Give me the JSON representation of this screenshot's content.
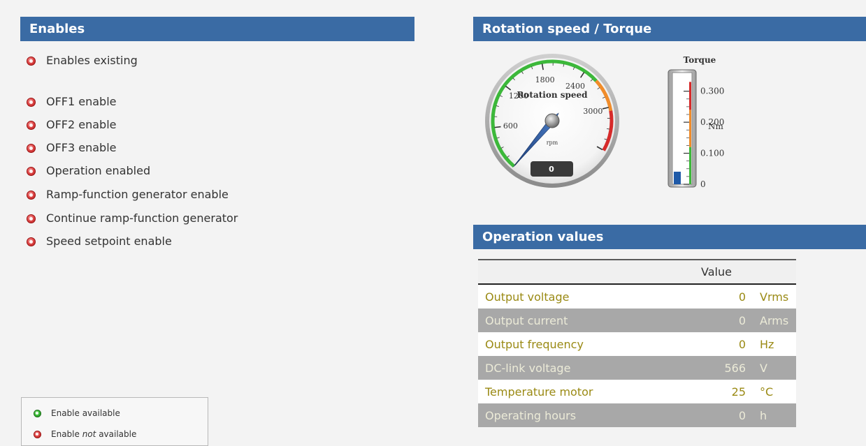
{
  "enables": {
    "title": "Enables",
    "items": [
      {
        "label": "Enables existing",
        "status": "not-available"
      },
      {
        "label": "OFF1 enable",
        "status": "not-available"
      },
      {
        "label": "OFF2 enable",
        "status": "not-available"
      },
      {
        "label": "OFF3 enable",
        "status": "not-available"
      },
      {
        "label": "Operation enabled",
        "status": "not-available"
      },
      {
        "label": "Ramp-function generator enable",
        "status": "not-available"
      },
      {
        "label": "Continue ramp-function generator",
        "status": "not-available"
      },
      {
        "label": "Speed setpoint enable",
        "status": "not-available"
      }
    ],
    "legend": {
      "available_label": "Enable available",
      "not_available_prefix": "Enable",
      "not_available_emphasis": "not",
      "not_available_suffix": "available"
    }
  },
  "rotation": {
    "title": "Rotation speed / Torque",
    "speed_gauge": {
      "title": "Rotation speed",
      "unit": "rpm",
      "tick_labels": [
        "600",
        "1200",
        "1800",
        "2400",
        "3000"
      ],
      "min": 0,
      "max": 3600,
      "value": 0,
      "readout": "0"
    },
    "torque_gauge": {
      "title": "Torque",
      "unit": "Nm",
      "tick_labels": [
        "0",
        "0.100",
        "0.200",
        "0.300"
      ],
      "value": 0
    }
  },
  "operation": {
    "title": "Operation values",
    "column_header": "Value",
    "rows": [
      {
        "label": "Output voltage",
        "value": "0",
        "unit": "Vrms"
      },
      {
        "label": "Output current",
        "value": "0",
        "unit": "Arms"
      },
      {
        "label": "Output frequency",
        "value": "0",
        "unit": "Hz"
      },
      {
        "label": "DC-link voltage",
        "value": "566",
        "unit": "V"
      },
      {
        "label": "Temperature motor",
        "value": "25",
        "unit": "°C"
      },
      {
        "label": "Operating hours",
        "value": "0",
        "unit": "h"
      }
    ]
  },
  "colors": {
    "header_bg": "#3a6ba4",
    "status_not_available": "#d83a3a",
    "status_available": "#3fbf3a",
    "table_text_light_row": "#9a8a14"
  },
  "icons": {
    "not_available": "red-status-led-icon",
    "available": "green-status-led-icon"
  }
}
